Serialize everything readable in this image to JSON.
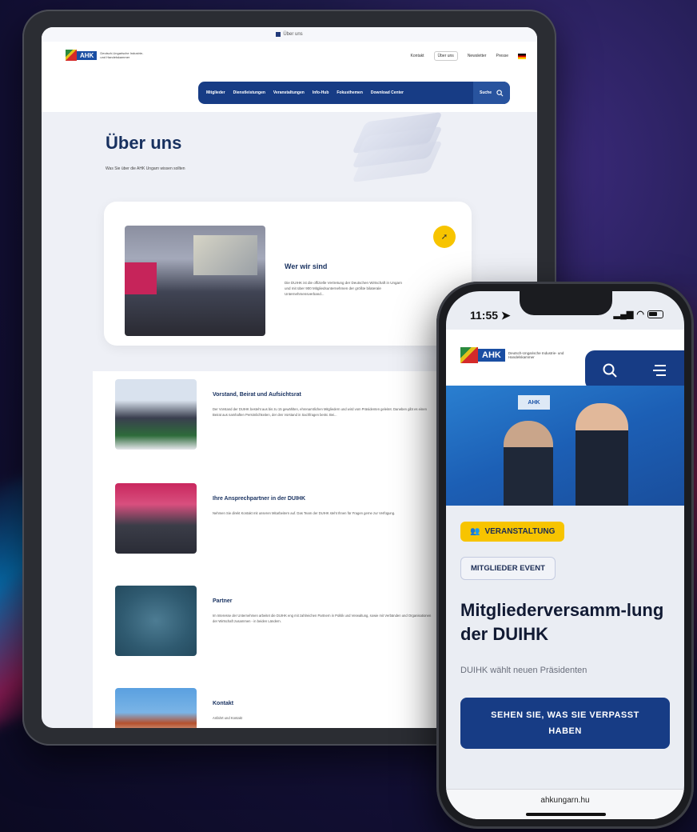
{
  "tablet": {
    "url": "Über uns",
    "logo": {
      "box": "AHK",
      "text": "Deutsch-Ungarische Industrie- und Handelskammer"
    },
    "top_links": [
      "Über uns",
      "Kontakt",
      "Newsletter",
      "Presse"
    ],
    "nav": [
      "Mitglieder",
      "Dienstleistungen",
      "Veranstaltungen",
      "Info-Hub",
      "Fokusthemen",
      "Download Center"
    ],
    "search_label": "Suche",
    "page_title": "Über uns",
    "page_subtitle": "Was Sie über die AHK Ungarn wissen sollten",
    "card": {
      "title": "Wer wir sind",
      "text": "Die DUIHK ist die offizielle Vertretung der Deutschen Wirtschaft in Ungarn und mit über 900 Mitgliedsunternehmen der größte bilaterale Unternehmensverband..."
    },
    "rows": [
      {
        "title": "Vorstand, Beirat und Aufsichtsrat",
        "text": "Der Vorstand der DUIHK besteht aus bis zu 15 gewählten, ehrenamtlichen Mitgliedern und wird vom Präsidenten geleitet. Daneben gibt es einen Beirat aus namhaften Persönlichkeiten, der den Vorstand in Sachfragen berät. Bei..."
      },
      {
        "title": "Ihre Ansprechpartner in der DUIHK",
        "text": "Nehmen Sie direkt Kontakt mit unseren Mitarbeitern auf. Das Team der DUIHK steht Ihnen für Fragen gerne zur Verfügung."
      },
      {
        "title": "Partner",
        "text": "Im Interesse der Unternehmen arbeitet die DUIHK eng mit zahlreichen Partnern in Politik und Verwaltung, sowie mit Verbänden und Organisationen der Wirtschaft zusammen - in beiden Ländern."
      },
      {
        "title": "Kontakt",
        "text": "Anfahrt und Kontakt"
      }
    ]
  },
  "phone": {
    "time": "11:55",
    "badge_event": "VERANSTALTUNG",
    "badge_type": "MITGLIEDER EVENT",
    "title": "Mitgliederversamm-lung der DUIHK",
    "subtitle": "DUIHK wählt neuen Präsidenten",
    "cta": "SEHEN SIE, WAS SIE VERPASST HABEN",
    "url": "ahkungarn.hu",
    "hero_banner": "AHK"
  },
  "colors": {
    "brand_blue": "#173c85",
    "accent_yellow": "#f7c400"
  }
}
